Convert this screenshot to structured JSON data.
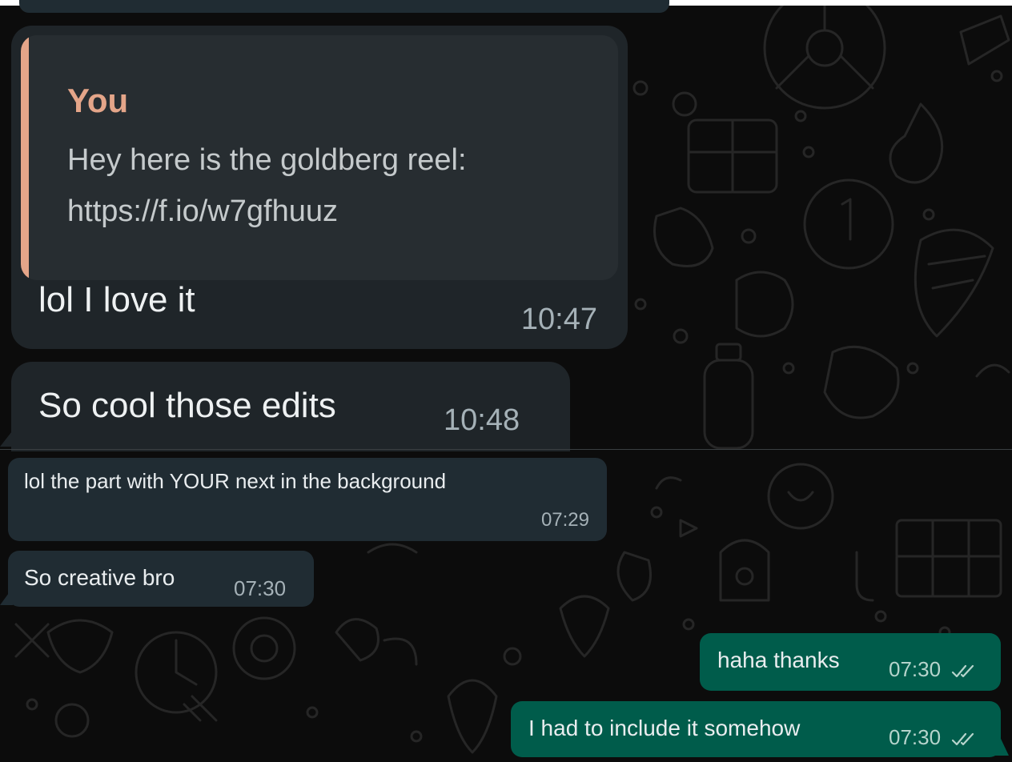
{
  "colors": {
    "background": "#0c0c0c",
    "incoming_bubble": "#202c33",
    "outgoing_bubble": "#005c4b",
    "quote_accent": "#e4a589",
    "timestamp": "#a5b1b7"
  },
  "messages": [
    {
      "direction": "incoming",
      "quote": {
        "author": "You",
        "text": "Hey here is the goldberg reel: https://f.io/w7gfhuuz"
      },
      "text": "lol I love it",
      "time": "10:47"
    },
    {
      "direction": "incoming",
      "text": "So cool those edits",
      "time": "10:48"
    },
    {
      "direction": "incoming",
      "text": "lol the part with YOUR next in the background",
      "time": "07:29"
    },
    {
      "direction": "incoming",
      "text": "So creative bro",
      "time": "07:30"
    },
    {
      "direction": "outgoing",
      "text": "haha thanks",
      "time": "07:30",
      "status_icon": "double-check-icon"
    },
    {
      "direction": "outgoing",
      "text": "I had to include it somehow",
      "time": "07:30",
      "status_icon": "double-check-icon"
    }
  ]
}
